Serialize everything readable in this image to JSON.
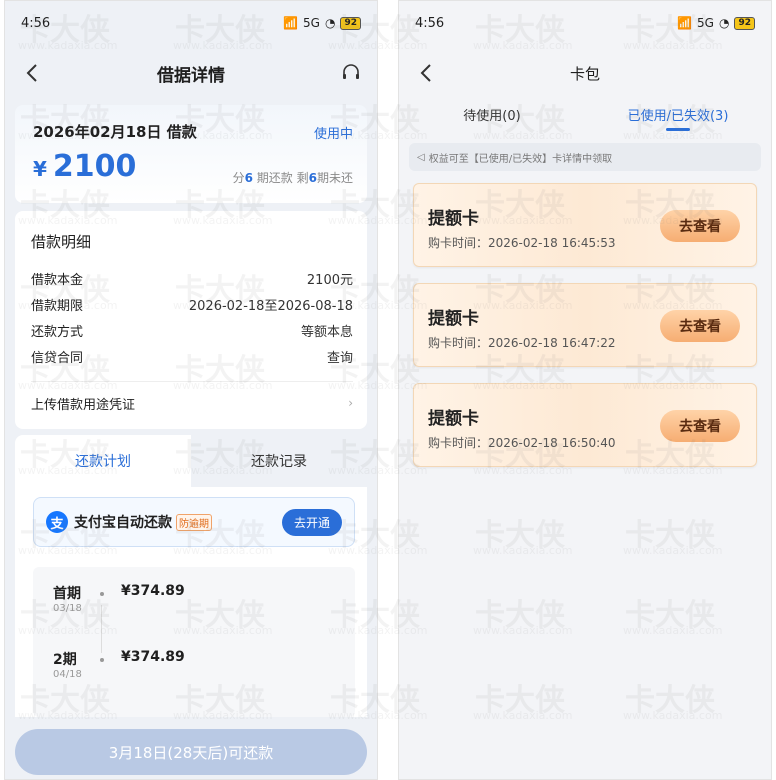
{
  "left": {
    "status": {
      "time": "4:56",
      "network": "5G",
      "battery": "92"
    },
    "nav": {
      "title": "借据详情"
    },
    "summary": {
      "date": "2026年02月18日 借款",
      "status": "使用中",
      "currency": "¥",
      "amount": "2100",
      "installment_prefix": "分",
      "installment_count": "6",
      "installment_mid": " 期还款 剩",
      "remaining_count": "6",
      "installment_suffix": "期未还"
    },
    "detail": {
      "title": "借款明细",
      "rows": [
        {
          "label": "借款本金",
          "value": "2100元"
        },
        {
          "label": "借款期限",
          "value": "2026-02-18至2026-08-18"
        },
        {
          "label": "还款方式",
          "value": "等额本息"
        },
        {
          "label": "信贷合同",
          "value": "查询"
        }
      ],
      "upload_label": "上传借款用途凭证"
    },
    "plan_tabs": {
      "plan": "还款计划",
      "record": "还款记录"
    },
    "alipay": {
      "label": "支付宝自动还款",
      "badge": "防逾期",
      "button": "去开通",
      "logo": "支"
    },
    "schedule": [
      {
        "period": "首期",
        "date": "03/18",
        "amount": "¥374.89"
      },
      {
        "period": "2期",
        "date": "04/18",
        "amount": "¥374.89"
      }
    ],
    "repay_button": "3月18日(28天后)可还款"
  },
  "right": {
    "status": {
      "time": "4:56",
      "network": "5G",
      "battery": "92"
    },
    "nav": {
      "title": "卡包"
    },
    "tabs": {
      "unused": "待使用(0)",
      "used": "已使用/已失效(3)"
    },
    "notice": "权益可至【已使用/已失效】卡详情中领取",
    "coupons": [
      {
        "name": "提额卡",
        "time_label": "购卡时间：",
        "time": "2026-02-18 16:45:53",
        "button": "去查看"
      },
      {
        "name": "提额卡",
        "time_label": "购卡时间：",
        "time": "2026-02-18 16:47:22",
        "button": "去查看"
      },
      {
        "name": "提额卡",
        "time_label": "购卡时间：",
        "time": "2026-02-18 16:50:40",
        "button": "去查看"
      }
    ]
  },
  "watermark": {
    "brand": "卡大侠",
    "url": "www.kadaxia.com"
  },
  "colors": {
    "accent": "#2a6ed8",
    "coupon_button": "#f6ad72",
    "disabled_button": "#b9c9e4"
  }
}
